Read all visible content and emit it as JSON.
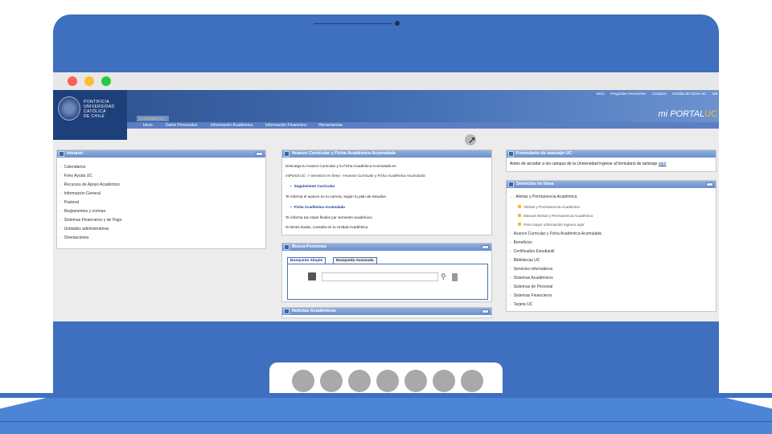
{
  "browser": {
    "traffic": [
      "#ff5f57",
      "#ffbd2e",
      "#28c840"
    ]
  },
  "header": {
    "logo_lines": [
      "PONTIFICIA",
      "UNIVERSIDAD",
      "CATÓLICA",
      "DE CHILE"
    ],
    "top_links": [
      "Inicio",
      "Preguntas Frecuentes",
      "Contacto",
      "Cambio de Clave UC",
      "Sal"
    ],
    "brand_prefix": "mi PORTAL",
    "brand_suffix": "UC",
    "active_tab": "Comunidad UC",
    "nav": [
      "Inicio",
      "Datos Personales",
      "Información Académica",
      "Información Financiera",
      "Herramientas"
    ]
  },
  "intranet": {
    "title": "Intranet",
    "items": [
      "Calendarios",
      "Fono Ayuda UC",
      "Recursos de Apoyo Académico",
      "Información General",
      "Pastoral",
      "Reglamentos y normas",
      "Sistemas Financieros y de Pago",
      "Unidades administrativas",
      "Orientaciones"
    ]
  },
  "avance": {
    "title": "Avance Curricular y Ficha Académica Acumulada",
    "line1": "Descarga tu Avance Curricular y tu Ficha Académica Acumulada en",
    "line2": "miPortal UC -> Servicios en línea ->Avance Curricular y Ficha Académica Acumulada",
    "link1": "Seguimiento Curricular",
    "line3": "Te informa el avance en tu carrera, según tu plan de estudios.",
    "link2": "Ficha Académica Acumulada",
    "line4": "Te informa tus notas finales por semestre académico.",
    "line5": "Si tienes dudas, consulta en tu Unidad Académica"
  },
  "busca": {
    "title": "Busca Personas",
    "tab_simple": "Busqueda Simple",
    "tab_advanced": "Busqueda Avanzada"
  },
  "noticias": {
    "title": "Noticias Académicas"
  },
  "tamizaje": {
    "title": "Formulario de tamizaje UC",
    "text": "Antes de acceder a los campus de la Universidad ingrese al formulario de tamizaje",
    "link": "aquí"
  },
  "servicios": {
    "title": "Servicios en línea",
    "expanded": "Alertas y Permanencia Académica",
    "sub1": "Alertas y Permanencia Académica",
    "sub2": "Manual Alertas y Permanencia Académica",
    "sub3": "Para mayor información ingresa aquí",
    "items": [
      "Avance Curricular y Ficha Académica Acumulada",
      "Beneficios",
      "Certificados Estudiantil",
      "Bibliotecas UC",
      "Servicios informáticos",
      "Sistemas Académicos",
      "Sistemas de Personal",
      "Sistemas Financieros",
      "Tarjeta UC"
    ]
  }
}
